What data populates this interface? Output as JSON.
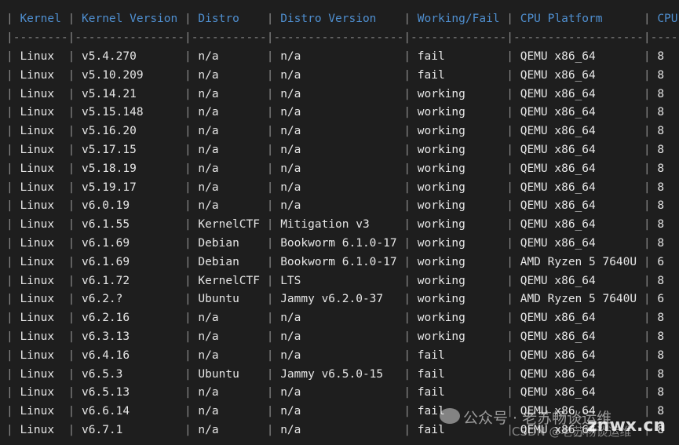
{
  "table": {
    "headers": [
      "Kernel",
      "Kernel Version",
      "Distro",
      "Distro Version",
      "Working/Fail",
      "CPU Platform",
      "CPU"
    ],
    "rows": [
      [
        "Linux",
        "v5.4.270",
        "n/a",
        "n/a",
        "fail",
        "QEMU x86_64",
        "8"
      ],
      [
        "Linux",
        "v5.10.209",
        "n/a",
        "n/a",
        "fail",
        "QEMU x86_64",
        "8"
      ],
      [
        "Linux",
        "v5.14.21",
        "n/a",
        "n/a",
        "working",
        "QEMU x86_64",
        "8"
      ],
      [
        "Linux",
        "v5.15.148",
        "n/a",
        "n/a",
        "working",
        "QEMU x86_64",
        "8"
      ],
      [
        "Linux",
        "v5.16.20",
        "n/a",
        "n/a",
        "working",
        "QEMU x86_64",
        "8"
      ],
      [
        "Linux",
        "v5.17.15",
        "n/a",
        "n/a",
        "working",
        "QEMU x86_64",
        "8"
      ],
      [
        "Linux",
        "v5.18.19",
        "n/a",
        "n/a",
        "working",
        "QEMU x86_64",
        "8"
      ],
      [
        "Linux",
        "v5.19.17",
        "n/a",
        "n/a",
        "working",
        "QEMU x86_64",
        "8"
      ],
      [
        "Linux",
        "v6.0.19",
        "n/a",
        "n/a",
        "working",
        "QEMU x86_64",
        "8"
      ],
      [
        "Linux",
        "v6.1.55",
        "KernelCTF",
        "Mitigation v3",
        "working",
        "QEMU x86_64",
        "8"
      ],
      [
        "Linux",
        "v6.1.69",
        "Debian",
        "Bookworm 6.1.0-17",
        "working",
        "QEMU x86_64",
        "8"
      ],
      [
        "Linux",
        "v6.1.69",
        "Debian",
        "Bookworm 6.1.0-17",
        "working",
        "AMD Ryzen 5 7640U",
        "6"
      ],
      [
        "Linux",
        "v6.1.72",
        "KernelCTF",
        "LTS",
        "working",
        "QEMU x86_64",
        "8"
      ],
      [
        "Linux",
        "v6.2.?",
        "Ubuntu",
        "Jammy v6.2.0-37",
        "working",
        "AMD Ryzen 5 7640U",
        "6"
      ],
      [
        "Linux",
        "v6.2.16",
        "n/a",
        "n/a",
        "working",
        "QEMU x86_64",
        "8"
      ],
      [
        "Linux",
        "v6.3.13",
        "n/a",
        "n/a",
        "working",
        "QEMU x86_64",
        "8"
      ],
      [
        "Linux",
        "v6.4.16",
        "n/a",
        "n/a",
        "fail",
        "QEMU x86_64",
        "8"
      ],
      [
        "Linux",
        "v6.5.3",
        "Ubuntu",
        "Jammy v6.5.0-15",
        "fail",
        "QEMU x86_64",
        "8"
      ],
      [
        "Linux",
        "v6.5.13",
        "n/a",
        "n/a",
        "fail",
        "QEMU x86_64",
        "8"
      ],
      [
        "Linux",
        "v6.6.14",
        "n/a",
        "n/a",
        "fail",
        "QEMU x86_64",
        "8"
      ],
      [
        "Linux",
        "v6.7.1",
        "n/a",
        "n/a",
        "fail",
        "QEMU x86_64",
        "8"
      ]
    ]
  },
  "watermark": {
    "wechat": "公众号 · 老苏畅谈运维",
    "site": "znwx.cn",
    "csdn": "CSDN @老苏畅谈运维"
  },
  "colors": {
    "background": "#1e1e1e",
    "header": "#4f8fd0",
    "text": "#e6e6e6",
    "pipe": "#8a8a8a"
  }
}
